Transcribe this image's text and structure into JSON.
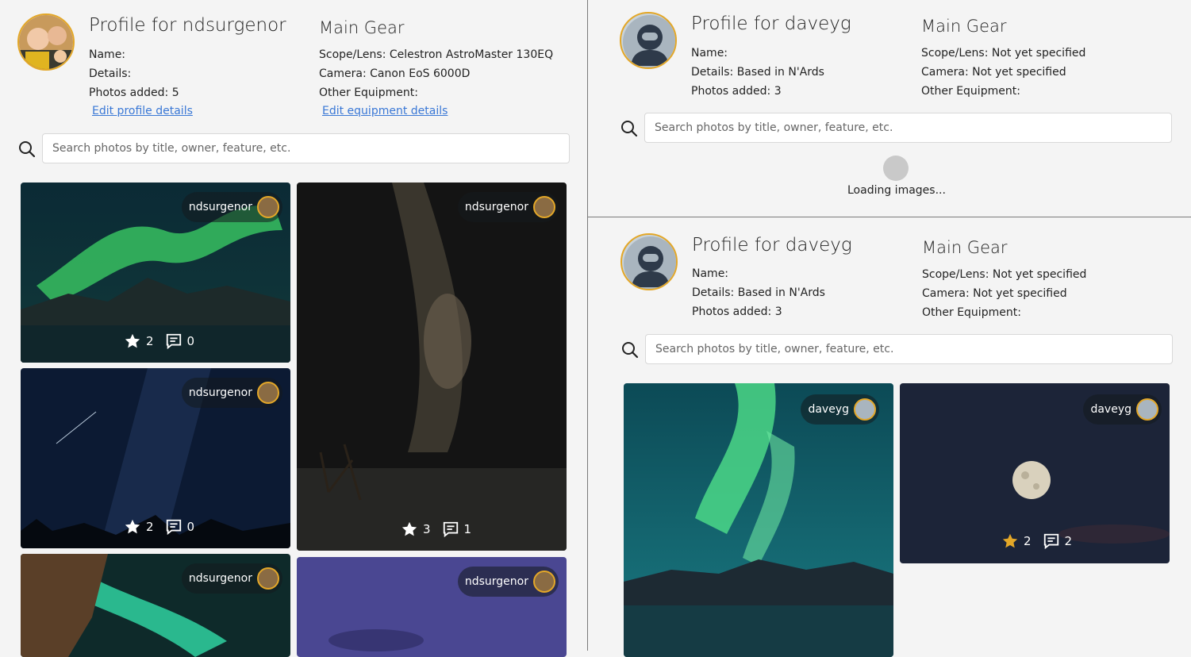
{
  "left": {
    "profile": {
      "title": "Profile for ndsurgenor",
      "name": "Name:",
      "details": "Details:",
      "photos_added": "Photos added: 5",
      "edit_profile": "Edit profile details"
    },
    "gear": {
      "title": "Main Gear",
      "scope": "Scope/Lens: Celestron AstroMaster 130EQ",
      "camera": "Camera: Canon EoS 6000D",
      "other": "Other Equipment:",
      "edit_equipment": "Edit equipment details"
    },
    "search_placeholder": "Search photos by title, owner, feature, etc.",
    "cards": [
      {
        "owner": "ndsurgenor",
        "stars": "2",
        "comments": "0"
      },
      {
        "owner": "ndsurgenor",
        "stars": "3",
        "comments": "1"
      },
      {
        "owner": "ndsurgenor",
        "stars": "2",
        "comments": "0"
      },
      {
        "owner": "ndsurgenor"
      },
      {
        "owner": "ndsurgenor"
      }
    ]
  },
  "right_top": {
    "profile": {
      "title": "Profile for daveyg",
      "name": "Name:",
      "details": "Details: Based in N'Ards",
      "photos_added": "Photos added: 3"
    },
    "gear": {
      "title": "Main Gear",
      "scope": "Scope/Lens: Not yet specified",
      "camera": "Camera: Not yet specified",
      "other": "Other Equipment:"
    },
    "search_placeholder": "Search photos by title, owner, feature, etc.",
    "loading_text": "Loading images..."
  },
  "right_bottom": {
    "profile": {
      "title": "Profile for daveyg",
      "name": "Name:",
      "details": "Details: Based in N'Ards",
      "photos_added": "Photos added: 3"
    },
    "gear": {
      "title": "Main Gear",
      "scope": "Scope/Lens: Not yet specified",
      "camera": "Camera: Not yet specified",
      "other": "Other Equipment:"
    },
    "search_placeholder": "Search photos by title, owner, feature, etc.",
    "cards": [
      {
        "owner": "daveyg"
      },
      {
        "owner": "daveyg",
        "stars": "2",
        "comments": "2",
        "starred": true
      }
    ]
  },
  "icons": [
    "search-icon",
    "star-icon",
    "comment-icon",
    "astronaut-avatar-icon"
  ],
  "colors": {
    "accent_gold": "#e3a728",
    "link_blue": "#3a78d6"
  }
}
